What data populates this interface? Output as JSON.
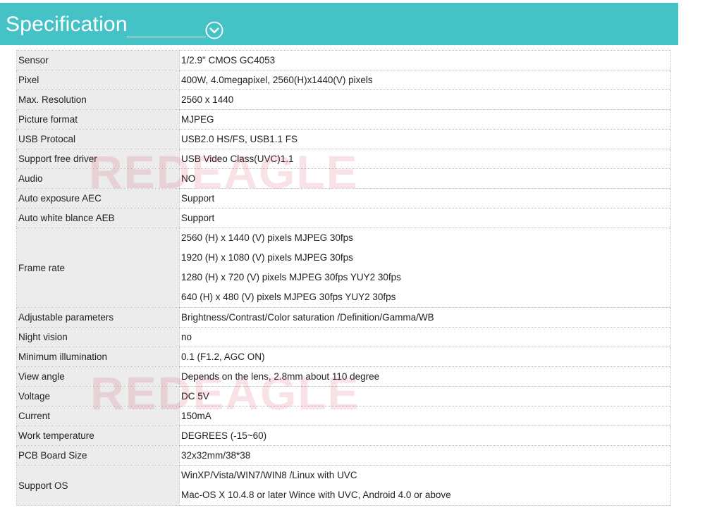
{
  "header": {
    "title": "Specification",
    "icon": "chevron-down-circle-icon",
    "background_color": "#44c2c6"
  },
  "watermark": "REDEAGLE",
  "specs": {
    "sensor": {
      "label": "Sensor",
      "value": "1/2.9\" CMOS GC4053"
    },
    "pixel": {
      "label": "Pixel",
      "value": "400W, 4.0megapixel, 2560(H)x1440(V) pixels"
    },
    "max_resolution": {
      "label": "Max. Resolution",
      "value": "2560 x 1440"
    },
    "picture_format": {
      "label": "Picture format",
      "value": "MJPEG"
    },
    "usb_protocol": {
      "label": "USB Protocal",
      "value": "USB2.0 HS/FS, USB1.1 FS"
    },
    "driver": {
      "label": "Support free driver",
      "value": "USB Video Class(UVC)1.1"
    },
    "audio": {
      "label": "Audio",
      "value": "NO"
    },
    "aec": {
      "label": "Auto exposure AEC",
      "value": "Support"
    },
    "aeb": {
      "label": "Auto white blance AEB",
      "value": "Support"
    },
    "frame_rate": {
      "label": "Frame rate",
      "lines": [
        "2560 (H) x 1440 (V) pixels   MJPEG 30fps",
        "1920 (H) x 1080 (V) pixels   MJPEG 30fps",
        "1280 (H) x 720 (V) pixels   MJPEG 30fps       YUY2 30fps",
        "640 (H) x 480 (V) pixels   MJPEG 30fps       YUY2 30fps"
      ]
    },
    "adjustable": {
      "label": "Adjustable parameters",
      "value": "Brightness/Contrast/Color saturation /Definition/Gamma/WB"
    },
    "night_vision": {
      "label": "Night vision",
      "value": "no"
    },
    "min_illumination": {
      "label": "Minimum illumination",
      "value": "0.1 (F1.2, AGC ON)"
    },
    "view_angle": {
      "label": "View angle",
      "value": "Depends on the lens, 2.8mm about 110 degree"
    },
    "voltage": {
      "label": "Voltage",
      "value": "DC 5V"
    },
    "current": {
      "label": "Current",
      "value": "150mA"
    },
    "work_temperature": {
      "label": "Work temperature",
      "value": "DEGREES (-15~60)"
    },
    "pcb_size": {
      "label": "PCB Board Size",
      "value": "32x32mm/38*38"
    },
    "support_os": {
      "label": "Support OS",
      "lines": [
        "WinXP/Vista/WIN7/WIN8 /Linux with UVC",
        "Mac-OS X 10.4.8 or later Wince with UVC,  Android 4.0 or above"
      ]
    }
  }
}
